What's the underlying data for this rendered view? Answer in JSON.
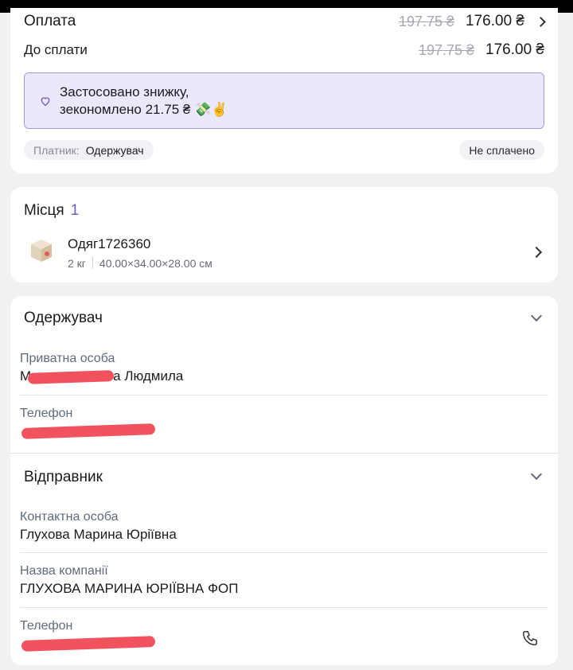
{
  "payment": {
    "title": "Оплата",
    "old_amount": "197.75 ₴",
    "new_amount": "176.00 ₴"
  },
  "due": {
    "title": "До сплати",
    "old_amount": "197.75 ₴",
    "new_amount": "176.00 ₴"
  },
  "discount": {
    "line1": "Застосовано знижку,",
    "line2": "зекономлено 21.75 ₴ 💸✌️"
  },
  "payer_chip": {
    "label": "Платник:",
    "value": "Одержувач"
  },
  "status_chip": "Не сплачено",
  "places": {
    "title": "Місця",
    "count": "1",
    "item": {
      "name": "Одяг1726360",
      "weight": "2 кг",
      "dimensions": "40.00×34.00×28.00 см"
    }
  },
  "recipient": {
    "title": "Одержувач",
    "type_label": "Приватна особа",
    "name_first_char": "М",
    "name_visible": "а Людмила",
    "phone_label": "Телефон"
  },
  "sender": {
    "title": "Відправник",
    "contact_label": "Контактна особа",
    "contact_value": "Глухова Марина Юріївна",
    "company_label": "Назва компанії",
    "company_value": "ГЛУХОВА МАРИНА ЮРІЇВНА ФОП",
    "phone_label": "Телефон"
  },
  "colors": {
    "accent": "#6b5fcc",
    "discount_bg": "#ece8fb",
    "discount_border": "#a79ae3",
    "redaction": "#f0525e"
  }
}
